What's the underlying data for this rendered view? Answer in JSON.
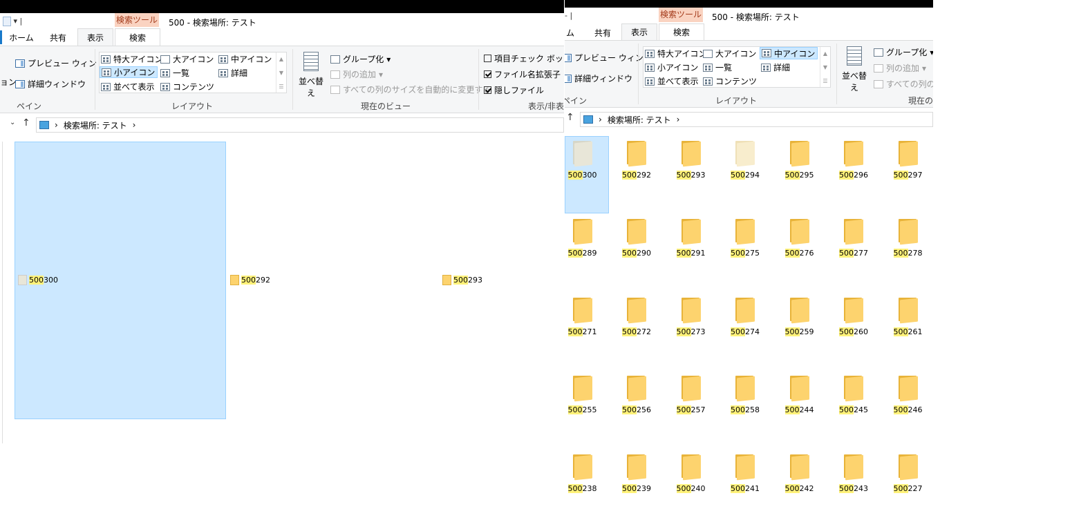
{
  "left": {
    "qat": "▾ |",
    "contextual_label": "検索ツール",
    "contextual_tab": "検索",
    "window_title": "500 - 検索場所: テスト",
    "tabs": [
      "ホーム",
      "共有",
      "表示"
    ],
    "pane": {
      "cut_label": "ョン",
      "preview": "プレビュー ウィンドウ",
      "details": "詳細ウィンドウ",
      "group": "ペイン"
    },
    "layout": {
      "items": [
        "特大アイコン",
        "大アイコン",
        "中アイコン",
        "小アイコン",
        "一覧",
        "詳細",
        "並べて表示",
        "コンテンツ"
      ],
      "selected": "小アイコン",
      "group": "レイアウト"
    },
    "view": {
      "sort": "並べ替え",
      "group_by": "グループ化",
      "add_column": "列の追加",
      "fit_columns": "すべての列のサイズを自動的に変更する",
      "group": "現在のビュー"
    },
    "showhide": {
      "item_check": "項目チェック ボックス",
      "extensions": "ファイル名拡張子",
      "hidden": "隠しファイル",
      "group": "表示/非表",
      "item_check_checked": false,
      "extensions_checked": true,
      "hidden_checked": true
    },
    "address": [
      "検索場所: テスト"
    ],
    "items": [
      {
        "prefix": "500",
        "rest": "300",
        "selected": true
      },
      {
        "prefix": "500",
        "rest": "292",
        "selected": false
      },
      {
        "prefix": "500",
        "rest": "293",
        "selected": false
      }
    ]
  },
  "right": {
    "qat": "- |",
    "contextual_label": "検索ツール",
    "contextual_tab": "検索",
    "window_title": "500 - 検索場所: テスト",
    "tabs": [
      "ム",
      "共有",
      "表示"
    ],
    "pane": {
      "preview": "プレビュー ウィンドウ",
      "details": "詳細ウィンドウ",
      "group": "ペイン"
    },
    "layout": {
      "items": [
        "特大アイコン",
        "大アイコン",
        "中アイコン",
        "小アイコン",
        "一覧",
        "詳細",
        "並べて表示",
        "コンテンツ"
      ],
      "selected": "中アイコン",
      "group": "レイアウト"
    },
    "view": {
      "sort": "並べ替え",
      "group_by": "グループ化",
      "add_column": "列の追加",
      "fit_columns": "すべての列のサ",
      "group": "現在の"
    },
    "address": [
      "検索場所: テスト"
    ],
    "items": [
      {
        "prefix": "500",
        "rest": "300",
        "style": "grey",
        "selected": true
      },
      {
        "prefix": "500",
        "rest": "292"
      },
      {
        "prefix": "500",
        "rest": "293"
      },
      {
        "prefix": "500",
        "rest": "294",
        "style": "pale"
      },
      {
        "prefix": "500",
        "rest": "295"
      },
      {
        "prefix": "500",
        "rest": "296"
      },
      {
        "prefix": "500",
        "rest": "297"
      },
      {
        "prefix": "500",
        "rest": "289"
      },
      {
        "prefix": "500",
        "rest": "290"
      },
      {
        "prefix": "500",
        "rest": "291"
      },
      {
        "prefix": "500",
        "rest": "275"
      },
      {
        "prefix": "500",
        "rest": "276"
      },
      {
        "prefix": "500",
        "rest": "277"
      },
      {
        "prefix": "500",
        "rest": "278"
      },
      {
        "prefix": "500",
        "rest": "271"
      },
      {
        "prefix": "500",
        "rest": "272"
      },
      {
        "prefix": "500",
        "rest": "273"
      },
      {
        "prefix": "500",
        "rest": "274"
      },
      {
        "prefix": "500",
        "rest": "259"
      },
      {
        "prefix": "500",
        "rest": "260"
      },
      {
        "prefix": "500",
        "rest": "261"
      },
      {
        "prefix": "500",
        "rest": "255"
      },
      {
        "prefix": "500",
        "rest": "256"
      },
      {
        "prefix": "500",
        "rest": "257"
      },
      {
        "prefix": "500",
        "rest": "258"
      },
      {
        "prefix": "500",
        "rest": "244"
      },
      {
        "prefix": "500",
        "rest": "245"
      },
      {
        "prefix": "500",
        "rest": "246"
      },
      {
        "prefix": "500",
        "rest": "238"
      },
      {
        "prefix": "500",
        "rest": "239"
      },
      {
        "prefix": "500",
        "rest": "240"
      },
      {
        "prefix": "500",
        "rest": "241"
      },
      {
        "prefix": "500",
        "rest": "242"
      },
      {
        "prefix": "500",
        "rest": "243"
      },
      {
        "prefix": "500",
        "rest": "227"
      }
    ]
  },
  "icons": [
    "folder-icon",
    "drive-icon",
    "up-arrow-icon",
    "chevron-right-icon",
    "checkbox-icon",
    "sort-icon"
  ],
  "colors": {
    "selection": "#cce8ff",
    "highlight": "#fff27a",
    "contextual": "#fad3c1",
    "folder": "#fdd36e"
  }
}
